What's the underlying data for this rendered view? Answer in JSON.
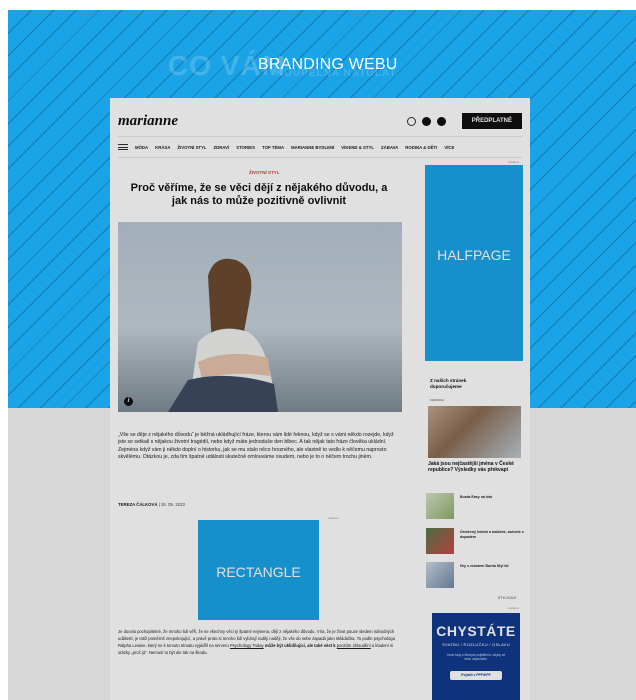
{
  "branding": {
    "label": "BRANDING WEBU",
    "ghost_text_1": "CO VÁM",
    "ghost_text_2": "KOUPELNA NATOLAT"
  },
  "site": {
    "logo": "marianne",
    "subscribe_label": "PŘEDPLATNÉ",
    "nav": [
      "MÓDA",
      "KRÁSA",
      "ŽIVOTNÍ STYL",
      "ZDRAVÍ",
      "STORIES",
      "TOP TÉMA",
      "MARIANNE BYDLENÍ",
      "VÍKEND & STYL",
      "ZÁBAVA",
      "RODINA & DĚTI",
      "VÍCE"
    ]
  },
  "article": {
    "category": "ŽIVOTNÍ STYL",
    "title": "Proč věříme, že se věci dějí z nějakého důvodu, a jak nás to může pozitivně ovlivnit",
    "info_badge": "i",
    "perex": "„Vše se děje z nějakého důvodu“ je běžná ukládhující fráze, kterou vám lidé řeknou, když se s vámi někdo rozejde, když jste se setkali s nějakou životní tragédií, nebo když máte jednoduše den blbec. A tak nějak tato fráze člověka ukládní. Zejména když vám ji někdo doplní o historku, jak se mu stalo něco hrozného, ale vlastně to vedlo k něčemu naprosto skvělému. Otázkou je, zda tím špatné události skutečně omlouváme osudem, nebo je to o něčem trochu jiném.",
    "author": "TEREZA ČÁLKOVÁ",
    "date": "26. 05. 2023",
    "ad_label": "reklama",
    "body_text_1": "Je docela pochopitelné, že mnoho lidí věří, že se všechny věci ty špatné nejmena, dějí z nějakého důvodu. Víra, že je život pouze sledem náhodných událostí, je totiž poměrně znepokojující, a právě proto si mnoho lidí vybírají raději naději, že vše do sebe zapadá jako skládačka. To podle psychologa Ralpha Lewise, který se k tomuto tématu vyjádřil na serveru",
    "body_link_1": "Psychology Today",
    "body_text_2": "může být uklidňující, ale také vést k",
    "body_link_2": "pocitům zbloudění",
    "body_text_3": "a kladení si otázky „proč já“. Nemusí to být ale tak na škodu."
  },
  "ads": {
    "halfpage_label": "HALFPAGE",
    "rectangle_label": "RECTANGLE"
  },
  "sidebar": {
    "heading_line1": "Z našich stránek",
    "heading_line2": "doporučujeme",
    "tag": "MAMINKA",
    "big_title": "Jaká jsou nejčastější jména v České republice? Výsledky vás překvapí",
    "items": [
      {
        "text": "Burda Easy na leto"
      },
      {
        "text": "Úsměvný lenček a babiček, začnete s dopadem"
      },
      {
        "text": "Hry s robotem Burda Styl kit"
      }
    ],
    "more": "STYL KOLE"
  },
  "promo": {
    "title": "CHYSTÁTE",
    "subtitle": "SVATBU / ROZLUČKU / OSLAVU",
    "note": "Jsme tady s libovým pojištěním, kdyby se něco nepovedlo.",
    "button": "Pojistit v PPF/KPF"
  },
  "colors": {
    "ad_blue": "#1aa3e6",
    "promo_navy": "#123a8f",
    "category_red": "#d63b3b"
  }
}
